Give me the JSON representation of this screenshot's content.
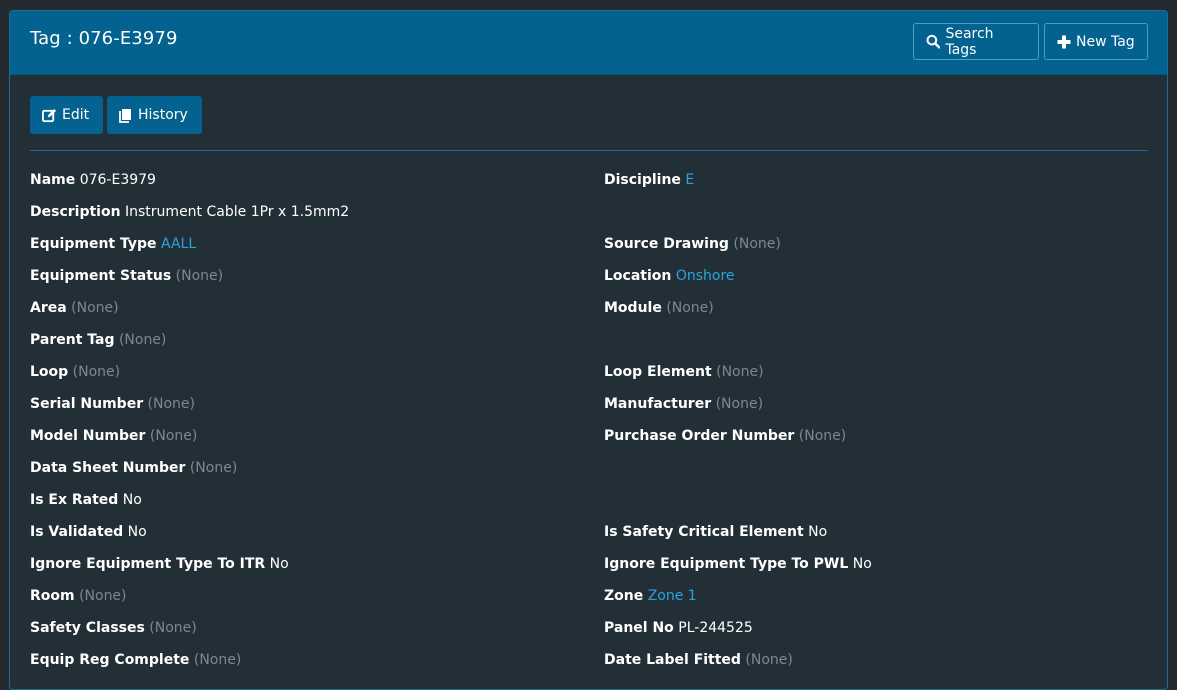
{
  "header": {
    "title": "Tag : 076-E3979",
    "search_label": "Search Tags",
    "new_label": "New Tag"
  },
  "actions": {
    "edit_label": "Edit",
    "history_label": "History"
  },
  "colors": {
    "header_bg": "#03628f",
    "panel_bg": "#232f37",
    "link": "#2aa3dc",
    "muted": "#7d8790"
  },
  "fields": {
    "name": {
      "label": "Name",
      "value": "076-E3979"
    },
    "discipline": {
      "label": "Discipline",
      "value": "E"
    },
    "description": {
      "label": "Description",
      "value": "Instrument Cable 1Pr x 1.5mm2"
    },
    "equipment_type": {
      "label": "Equipment Type",
      "value": "AALL"
    },
    "source_drawing": {
      "label": "Source Drawing",
      "value": "(None)"
    },
    "equipment_status": {
      "label": "Equipment Status",
      "value": "(None)"
    },
    "location": {
      "label": "Location",
      "value": "Onshore"
    },
    "area": {
      "label": "Area",
      "value": "(None)"
    },
    "module": {
      "label": "Module",
      "value": "(None)"
    },
    "parent_tag": {
      "label": "Parent Tag",
      "value": "(None)"
    },
    "loop": {
      "label": "Loop",
      "value": "(None)"
    },
    "loop_element": {
      "label": "Loop Element",
      "value": "(None)"
    },
    "serial_number": {
      "label": "Serial Number",
      "value": "(None)"
    },
    "manufacturer": {
      "label": "Manufacturer",
      "value": "(None)"
    },
    "model_number": {
      "label": "Model Number",
      "value": "(None)"
    },
    "purchase_order_number": {
      "label": "Purchase Order Number",
      "value": "(None)"
    },
    "data_sheet_number": {
      "label": "Data Sheet Number",
      "value": "(None)"
    },
    "is_ex_rated": {
      "label": "Is Ex Rated",
      "value": "No"
    },
    "is_validated": {
      "label": "Is Validated",
      "value": "No"
    },
    "is_safety_critical": {
      "label": "Is Safety Critical Element",
      "value": "No"
    },
    "ignore_itr": {
      "label": "Ignore Equipment Type To ITR",
      "value": "No"
    },
    "ignore_pwl": {
      "label": "Ignore Equipment Type To PWL",
      "value": "No"
    },
    "room": {
      "label": "Room",
      "value": "(None)"
    },
    "zone": {
      "label": "Zone",
      "value": "Zone 1"
    },
    "safety_classes": {
      "label": "Safety Classes",
      "value": "(None)"
    },
    "panel_no": {
      "label": "Panel No",
      "value": "PL-244525"
    },
    "equip_reg_complete": {
      "label": "Equip Reg Complete",
      "value": "(None)"
    },
    "date_label_fitted": {
      "label": "Date Label Fitted",
      "value": "(None)"
    }
  }
}
